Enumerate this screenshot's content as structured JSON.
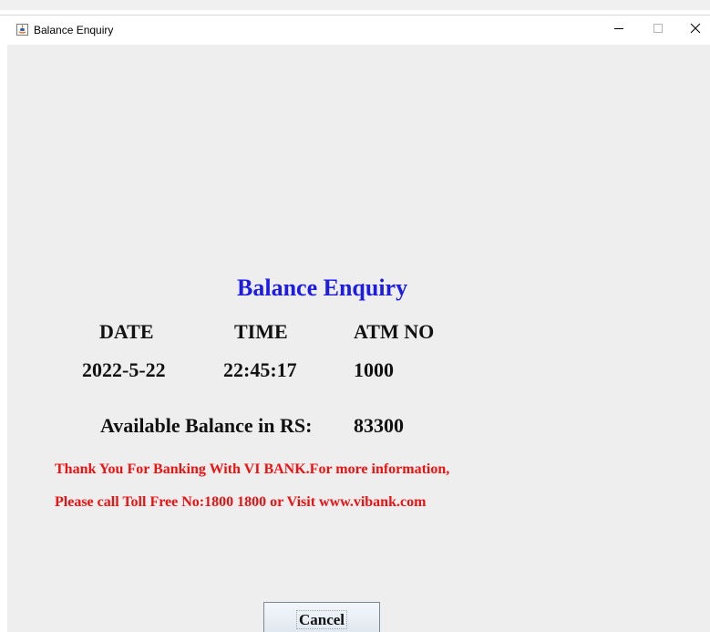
{
  "window": {
    "title": "Balance Enquiry",
    "app_icon": "java-cup-icon",
    "controls": {
      "minimize": "minimize-icon",
      "maximize": "maximize-icon",
      "close": "close-icon"
    }
  },
  "receipt": {
    "heading": "Balance Enquiry",
    "labels": {
      "date": "DATE",
      "time": "TIME",
      "atm_no": "ATM NO"
    },
    "values": {
      "date": "2022-5-22",
      "time": "22:45:17",
      "atm_no": "1000"
    },
    "balance_label": "Available Balance in RS:",
    "balance_value": "83300",
    "message_line1": "Thank You For Banking With VI BANK.For more information,",
    "message_line2": "Please call Toll Free No:1800 1800  or  Visit www.vibank.com"
  },
  "actions": {
    "cancel_label": "Cancel"
  },
  "colors": {
    "heading": "#1c1ce6",
    "message": "#ee1111",
    "panel_background": "#eeeeee"
  }
}
